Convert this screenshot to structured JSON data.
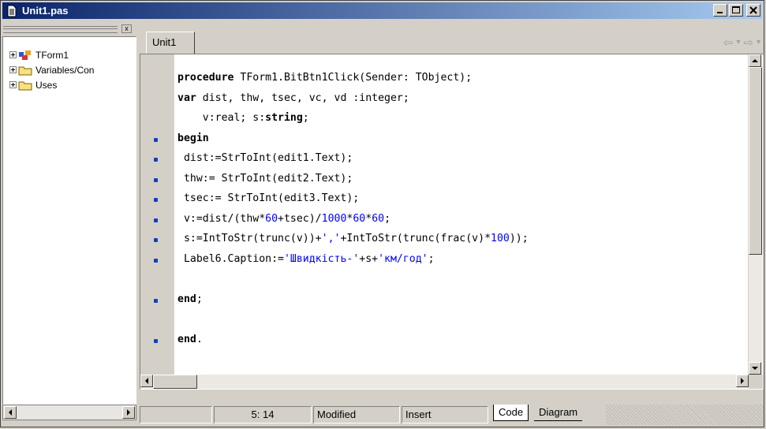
{
  "window": {
    "title": "Unit1.pas",
    "controls": [
      "minimize",
      "maximize",
      "close"
    ]
  },
  "explorer": {
    "close_label": "x",
    "tree": [
      {
        "label": "TForm1",
        "icon": "form-icon"
      },
      {
        "label": "Variables/Con",
        "icon": "folder-icon"
      },
      {
        "label": "Uses",
        "icon": "folder-icon"
      }
    ]
  },
  "editor": {
    "tab_label": "Unit1",
    "lines": [
      {
        "parts": [
          {
            "t": "procedure",
            "k": "kw"
          },
          {
            "t": " TForm1.BitBtn1Click(Sender: TObject);",
            "k": ""
          }
        ],
        "bullet": false
      },
      {
        "parts": [
          {
            "t": "var",
            "k": "kw"
          },
          {
            "t": " dist, thw, tsec, vc, vd :integer;",
            "k": ""
          }
        ],
        "bullet": false
      },
      {
        "parts": [
          {
            "t": "    v:real; s:",
            "k": ""
          },
          {
            "t": "string",
            "k": "kw"
          },
          {
            "t": ";",
            "k": ""
          }
        ],
        "bullet": false
      },
      {
        "parts": [
          {
            "t": "begin",
            "k": "kw"
          }
        ],
        "bullet": true
      },
      {
        "parts": [
          {
            "t": " dist:=StrToInt(edit1.Text);",
            "k": ""
          }
        ],
        "bullet": true
      },
      {
        "parts": [
          {
            "t": " thw:= StrToInt(edit2.Text);",
            "k": ""
          }
        ],
        "bullet": true
      },
      {
        "parts": [
          {
            "t": " tsec:= StrToInt(edit3.Text);",
            "k": ""
          }
        ],
        "bullet": true
      },
      {
        "parts": [
          {
            "t": " v:=dist/(thw*",
            "k": ""
          },
          {
            "t": "60",
            "k": "num"
          },
          {
            "t": "+tsec)/",
            "k": ""
          },
          {
            "t": "1000",
            "k": "num"
          },
          {
            "t": "*",
            "k": ""
          },
          {
            "t": "60",
            "k": "num"
          },
          {
            "t": "*",
            "k": ""
          },
          {
            "t": "60",
            "k": "num"
          },
          {
            "t": ";",
            "k": ""
          }
        ],
        "bullet": true
      },
      {
        "parts": [
          {
            "t": " s:=IntToStr(trunc(v))+",
            "k": ""
          },
          {
            "t": "','",
            "k": "str"
          },
          {
            "t": "+IntToStr(trunc(frac(v)*",
            "k": ""
          },
          {
            "t": "100",
            "k": "num"
          },
          {
            "t": "));",
            "k": ""
          }
        ],
        "bullet": true
      },
      {
        "parts": [
          {
            "t": " Label6.Caption:=",
            "k": ""
          },
          {
            "t": "'Швидкість-'",
            "k": "str"
          },
          {
            "t": "+s+",
            "k": ""
          },
          {
            "t": "'км/год'",
            "k": "str"
          },
          {
            "t": ";",
            "k": ""
          }
        ],
        "bullet": true
      },
      {
        "parts": [],
        "bullet": false
      },
      {
        "parts": [
          {
            "t": "end",
            "k": "kw"
          },
          {
            "t": ";",
            "k": ""
          }
        ],
        "bullet": true
      },
      {
        "parts": [],
        "bullet": false
      },
      {
        "parts": [
          {
            "t": "end",
            "k": "kw"
          },
          {
            "t": ".",
            "k": ""
          }
        ],
        "bullet": true
      }
    ]
  },
  "status": {
    "position": "5: 14",
    "modified": "Modified",
    "mode": "Insert",
    "tab_code": "Code",
    "tab_diagram": "Diagram"
  }
}
